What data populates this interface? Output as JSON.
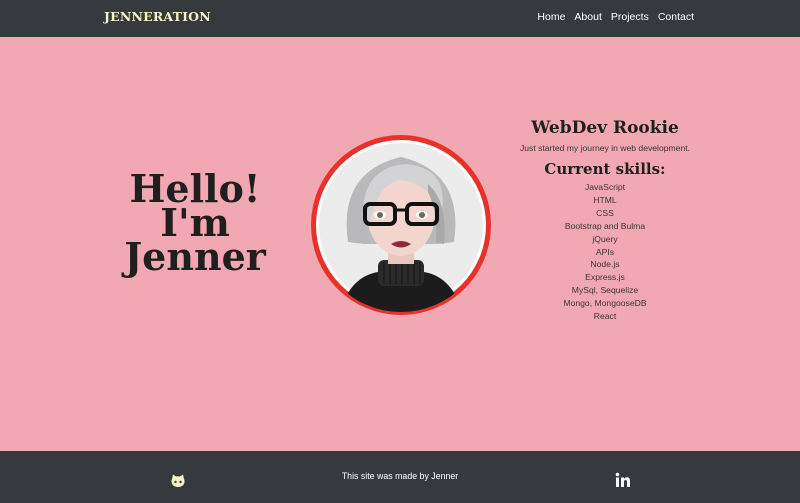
{
  "navbar": {
    "brand": "JENNERATION",
    "links": [
      "Home",
      "About",
      "Projects",
      "Contact"
    ]
  },
  "hero": {
    "greeting_line1": "Hello!",
    "greeting_line2": "I'm",
    "greeting_line3": "Jenner"
  },
  "profile": {
    "title": "WebDev Rookie",
    "subtitle": "Just started my journey in web development.",
    "skills_title": "Current skills:",
    "skills": [
      "JavaScript",
      "HTML",
      "CSS",
      "Bootstrap and Bulma",
      "jQuery",
      "APIs",
      "Node.js",
      "Express.js",
      "MySql, Sequelize",
      "Mongo, MongooseDB",
      "React"
    ]
  },
  "footer": {
    "text": "This site was made by Jenner",
    "icons": [
      "github-icon",
      "linkedin-icon"
    ]
  },
  "colors": {
    "background": "#f2a8b3",
    "navbar": "#363a3f",
    "brand": "#f7f0c2",
    "avatar_ring": "#e8312b"
  }
}
